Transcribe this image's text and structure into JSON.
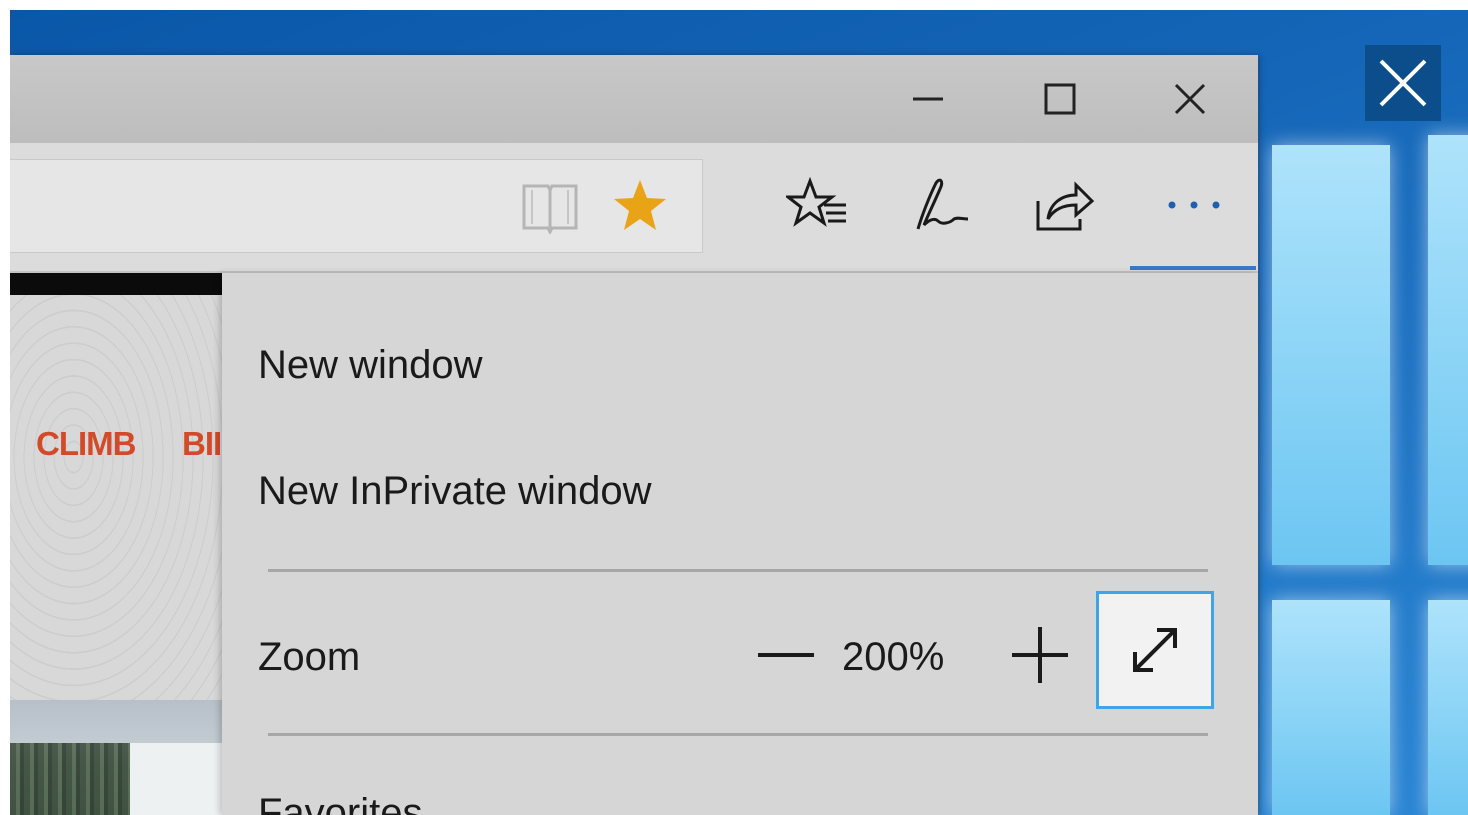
{
  "desktop": {
    "close_icon": "close-icon"
  },
  "window": {
    "controls": {
      "minimize_icon": "minimize-icon",
      "maximize_icon": "maximize-icon",
      "close_icon": "close-icon"
    }
  },
  "toolbar": {
    "address_icons": [
      "reading-view-icon",
      "favorite-star-icon"
    ],
    "buttons": [
      "hub-icon",
      "web-note-icon",
      "share-icon",
      "more-actions-icon"
    ],
    "accent_color": "#3a78c9",
    "star_color": "#e8a317"
  },
  "page": {
    "nav_items": [
      "CLIMB",
      "BII"
    ],
    "nav_color": "#d24a2a"
  },
  "menu": {
    "items": [
      {
        "label": "New window"
      },
      {
        "label": "New InPrivate window"
      }
    ],
    "zoom": {
      "label": "Zoom",
      "value": "200%",
      "decrease_icon": "minus-icon",
      "increase_icon": "plus-icon",
      "fullscreen_icon": "expand-arrows-icon",
      "focus_color": "#41a4e8"
    },
    "favorites_label": "Favorites"
  }
}
